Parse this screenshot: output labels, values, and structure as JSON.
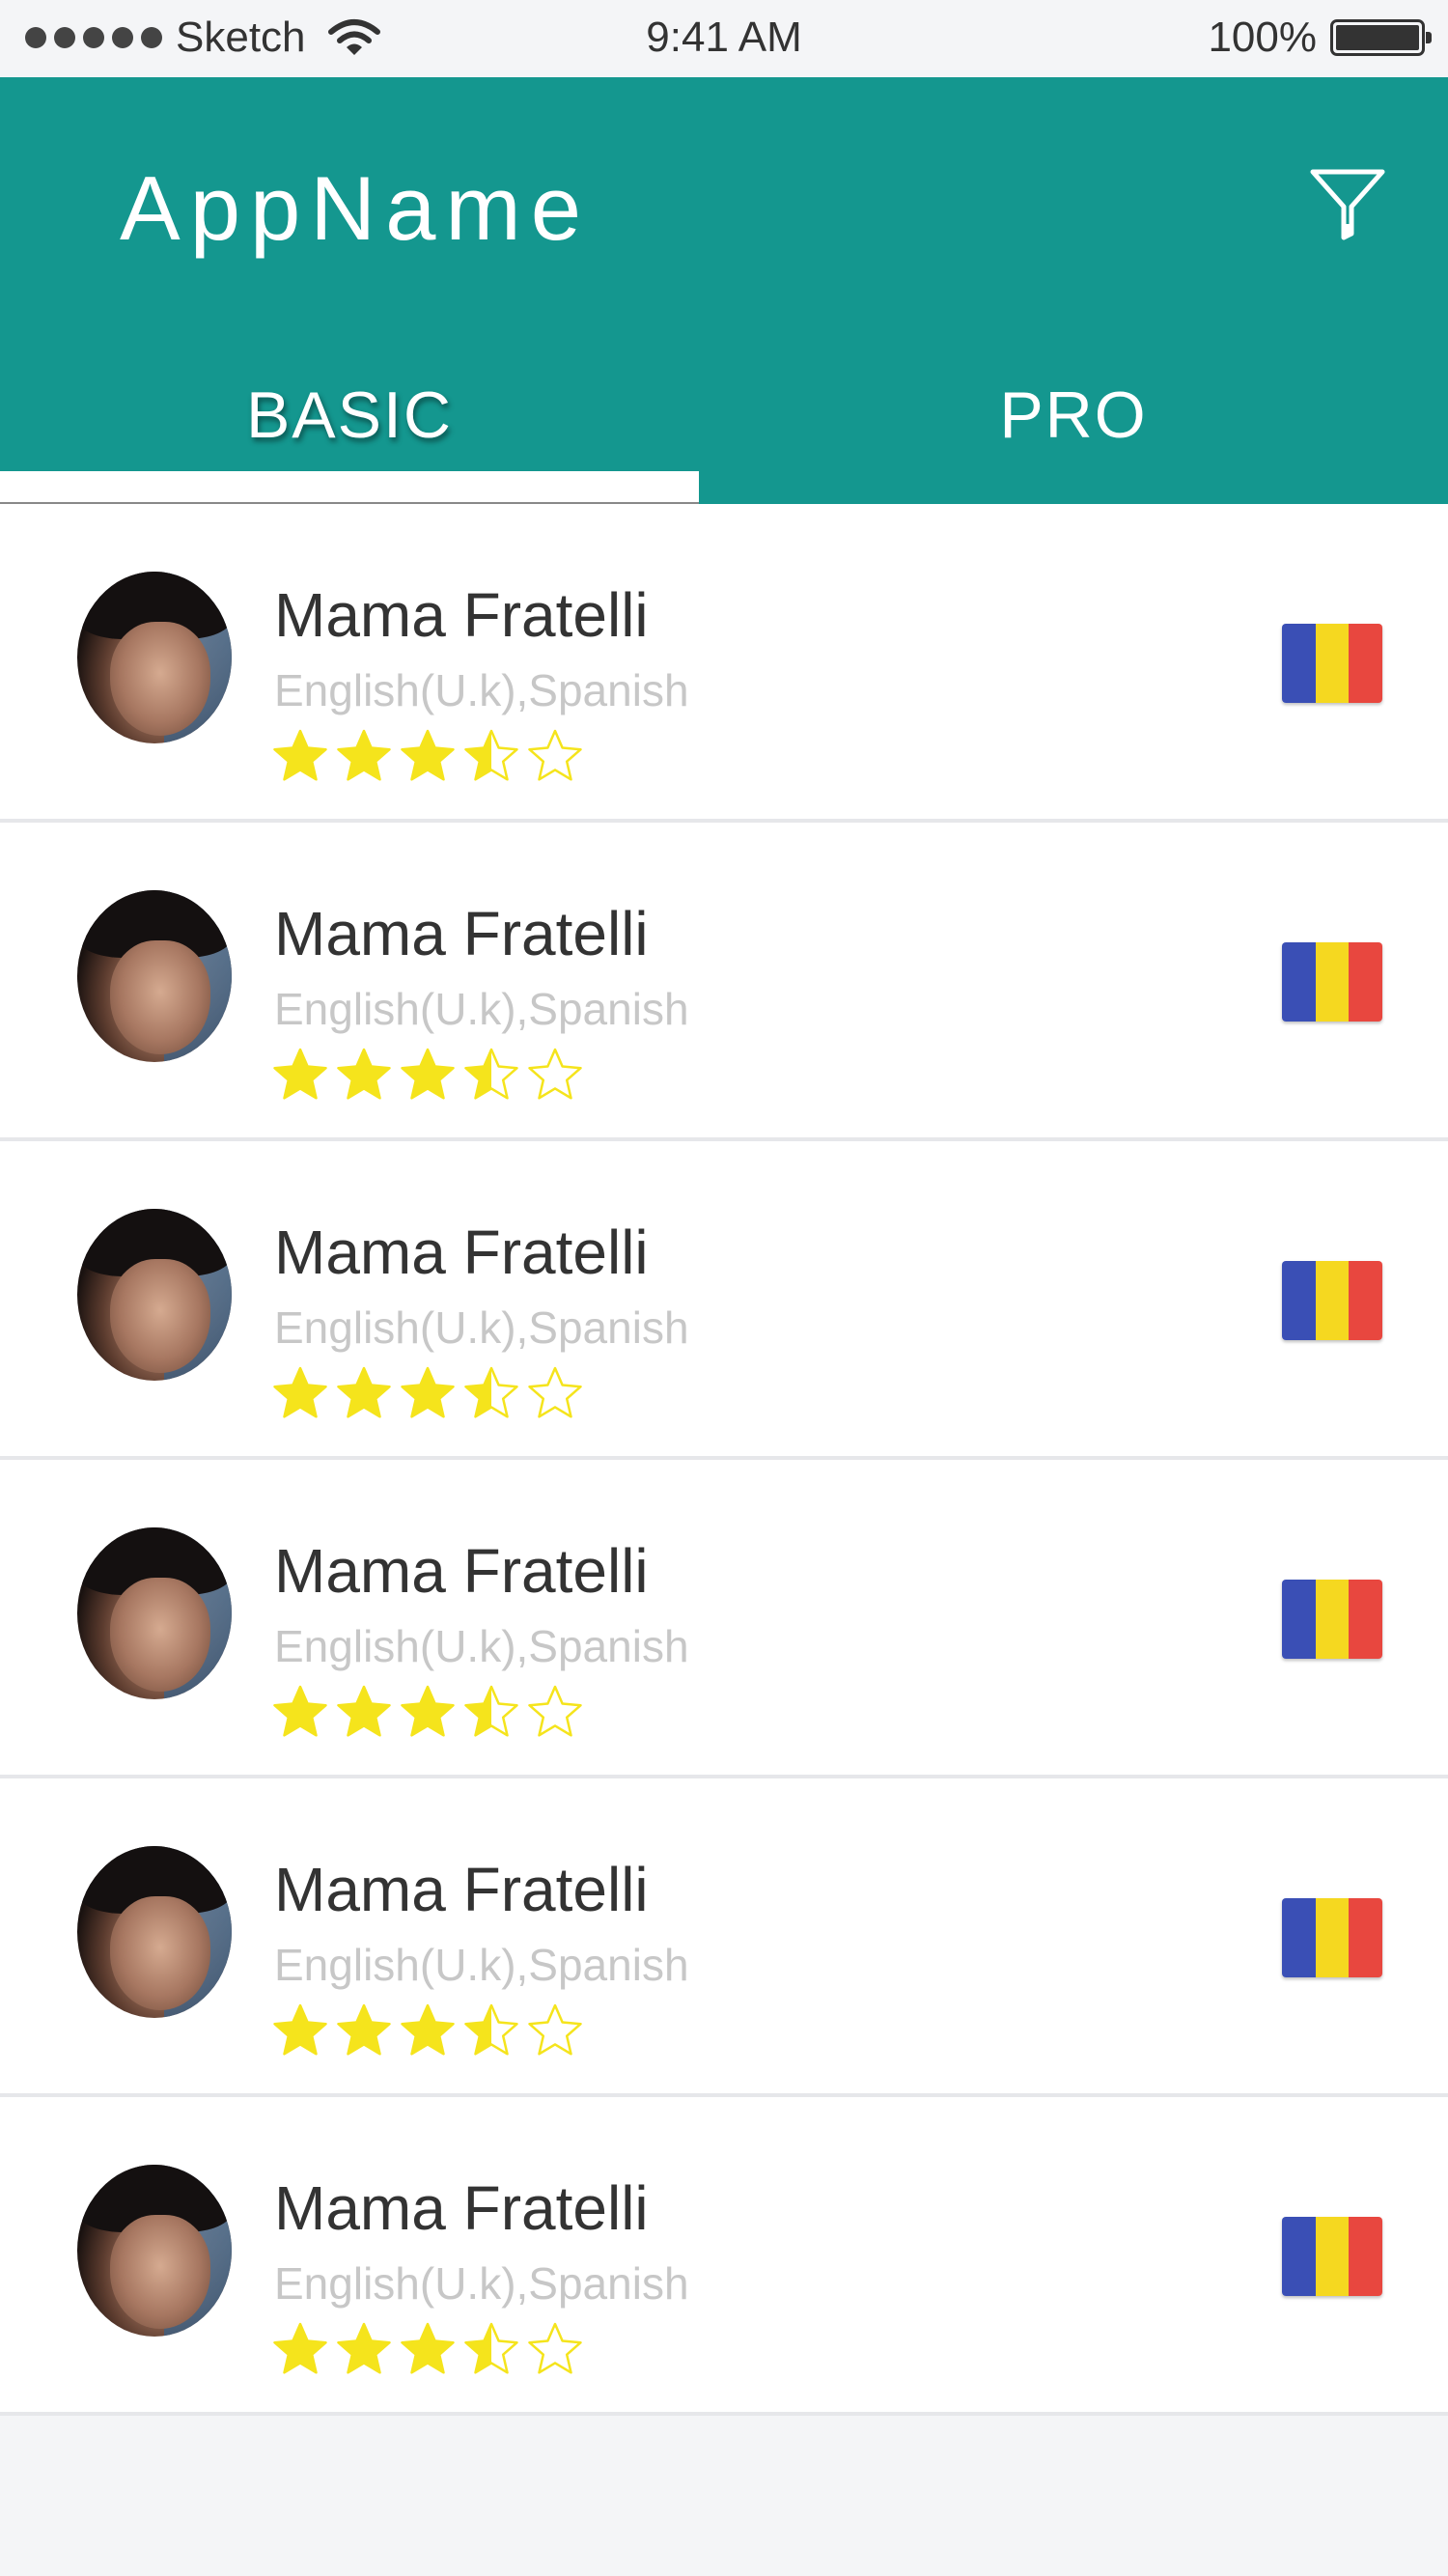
{
  "status_bar": {
    "carrier": "Sketch",
    "time": "9:41 AM",
    "battery": "100%"
  },
  "header": {
    "app_name": "AppName",
    "filter_icon": "filter-funnel-icon"
  },
  "tabs": [
    {
      "label": "BASIC",
      "selected": true
    },
    {
      "label": "PRO",
      "selected": false
    }
  ],
  "colors": {
    "header": "#14978f",
    "star": "#f5e41c",
    "flag_blue": "#3a4fb5",
    "flag_yellow": "#f5d820",
    "flag_red": "#e8473f"
  },
  "items": [
    {
      "name": "Mama Fratelli",
      "languages": "English(U.k),Spanish",
      "rating": 3.5,
      "rating_max": 5,
      "flag_icon": "flag-icon"
    },
    {
      "name": "Mama Fratelli",
      "languages": "English(U.k),Spanish",
      "rating": 3.5,
      "rating_max": 5,
      "flag_icon": "flag-icon"
    },
    {
      "name": "Mama Fratelli",
      "languages": "English(U.k),Spanish",
      "rating": 3.5,
      "rating_max": 5,
      "flag_icon": "flag-icon"
    },
    {
      "name": "Mama Fratelli",
      "languages": "English(U.k),Spanish",
      "rating": 3.5,
      "rating_max": 5,
      "flag_icon": "flag-icon"
    },
    {
      "name": "Mama Fratelli",
      "languages": "English(U.k),Spanish",
      "rating": 3.5,
      "rating_max": 5,
      "flag_icon": "flag-icon"
    },
    {
      "name": "Mama Fratelli",
      "languages": "English(U.k),Spanish",
      "rating": 3.5,
      "rating_max": 5,
      "flag_icon": "flag-icon"
    }
  ]
}
